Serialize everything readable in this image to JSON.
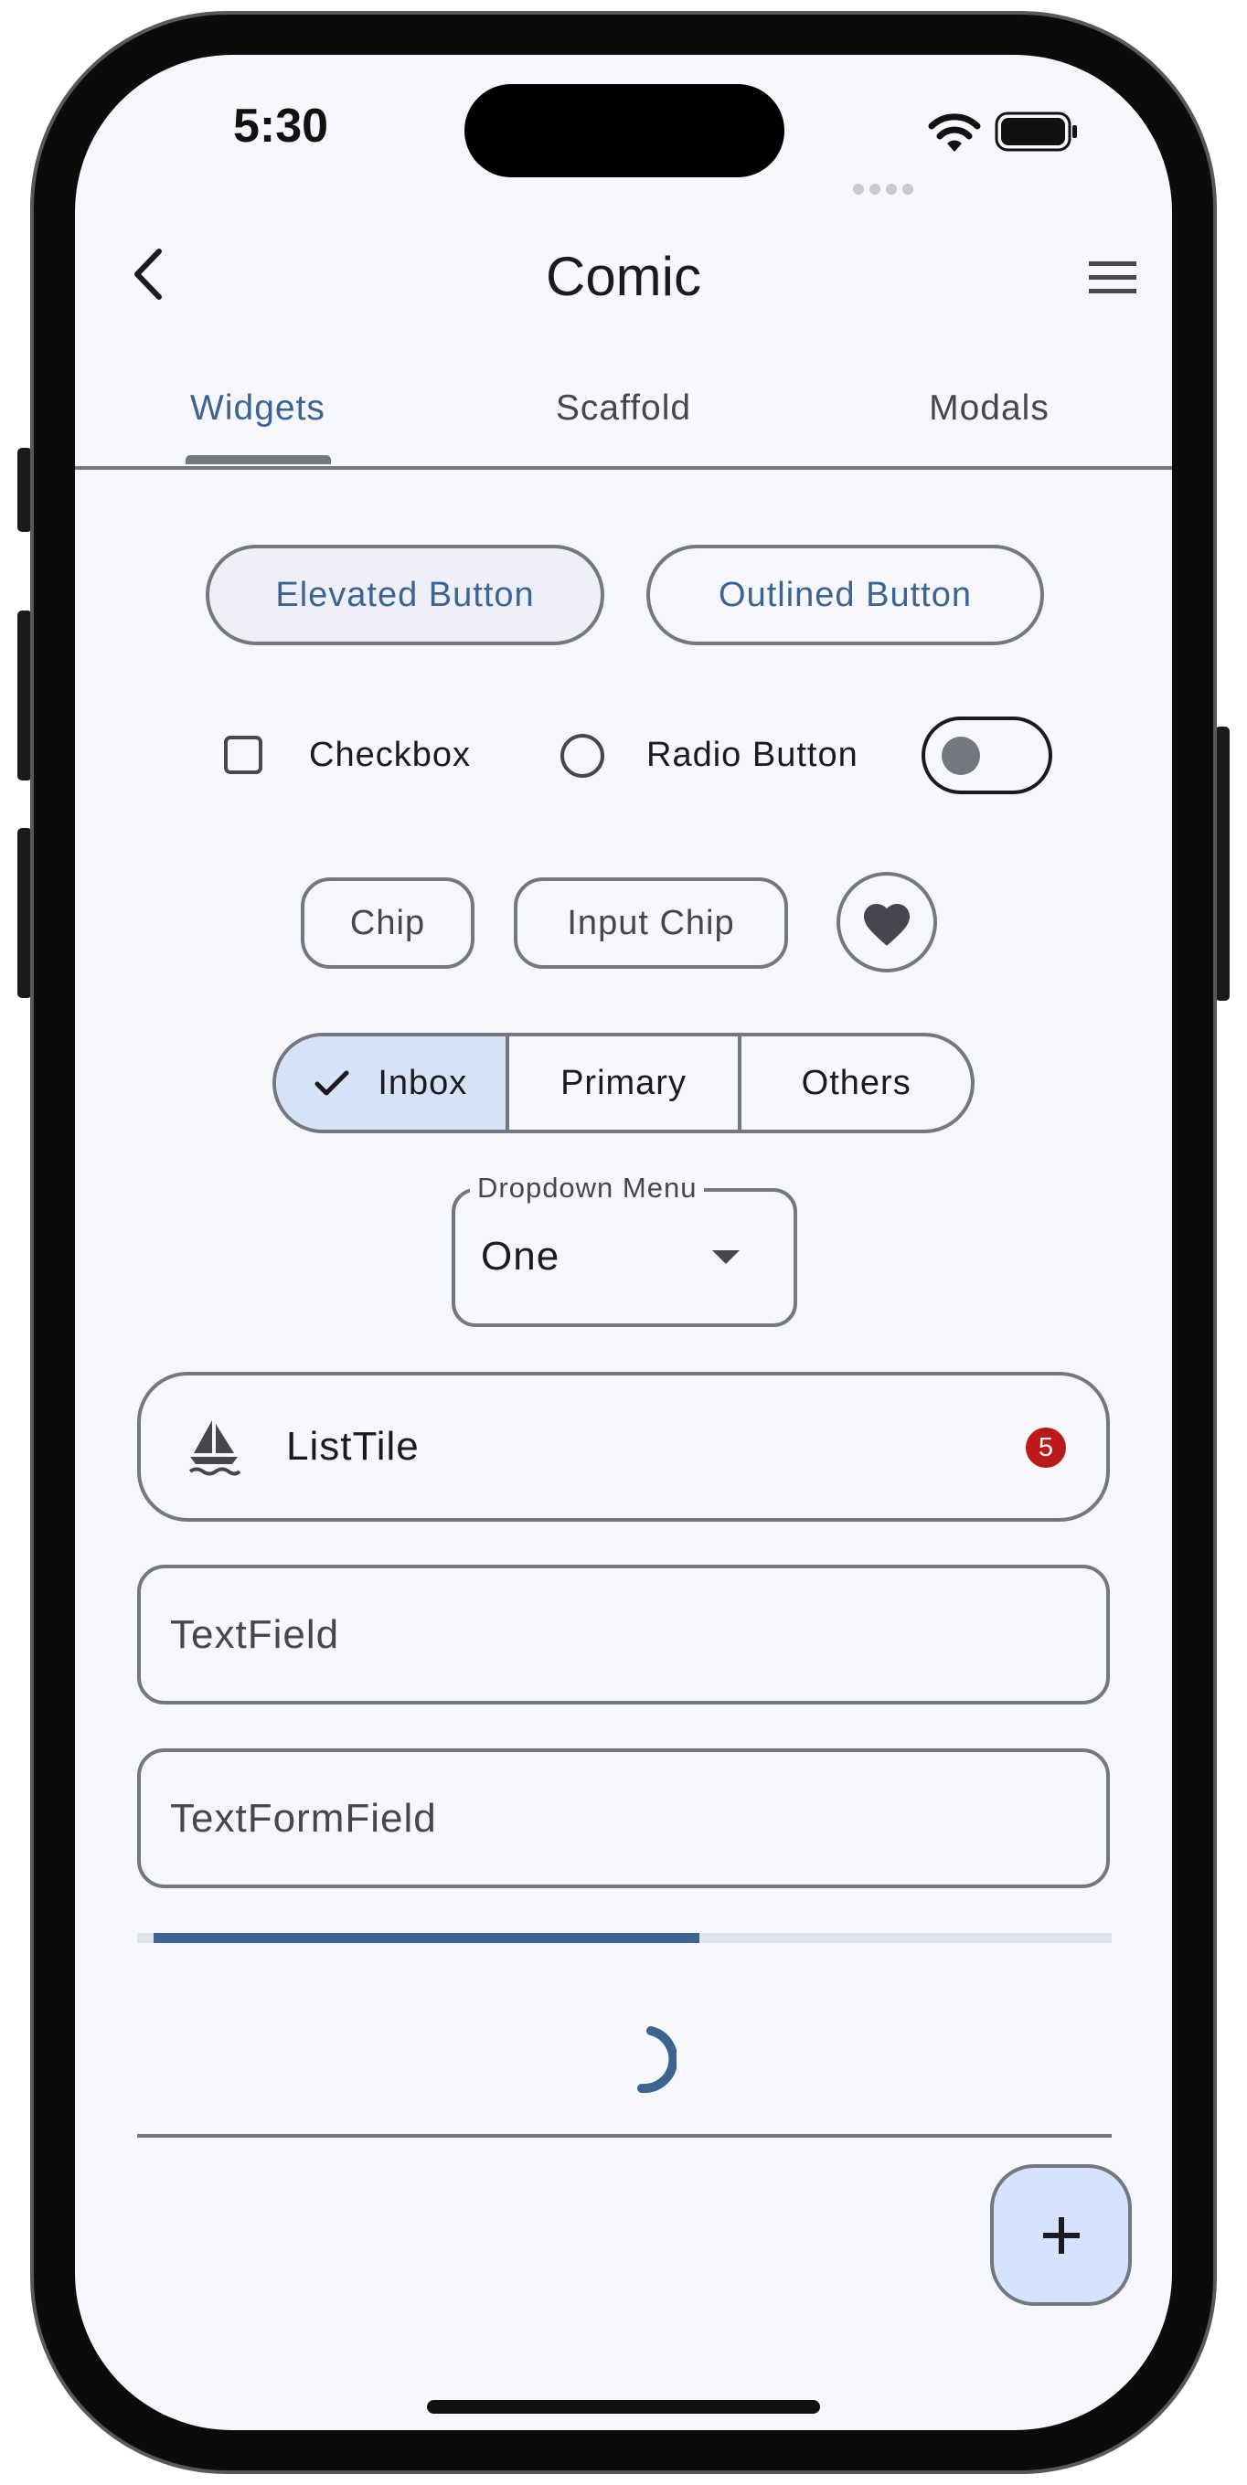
{
  "status_bar": {
    "time": "5:30"
  },
  "app_bar": {
    "title": "Comic"
  },
  "tabs": [
    {
      "label": "Widgets",
      "selected": true
    },
    {
      "label": "Scaffold",
      "selected": false
    },
    {
      "label": "Modals",
      "selected": false
    }
  ],
  "buttons": {
    "elevated": "Elevated Button",
    "outlined": "Outlined Button"
  },
  "controls": {
    "checkbox_label": "Checkbox",
    "radio_label": "Radio Button",
    "checkbox_checked": false,
    "radio_selected": false,
    "switch_on": false
  },
  "chips": {
    "chip": "Chip",
    "input_chip": "Input Chip"
  },
  "segmented": [
    {
      "label": "Inbox",
      "selected": true
    },
    {
      "label": "Primary",
      "selected": false
    },
    {
      "label": "Others",
      "selected": false
    }
  ],
  "dropdown": {
    "label": "Dropdown Menu",
    "value": "One"
  },
  "list_tile": {
    "title": "ListTile",
    "badge": "5"
  },
  "text_field": {
    "placeholder": "TextField"
  },
  "text_form_field": {
    "placeholder": "TextFormField"
  },
  "progress": {
    "value": 0.57
  },
  "colors": {
    "primary": "#3d6490",
    "error": "#ba1a1a",
    "outline": "#74777f",
    "surface": "#f6f7fc",
    "secondary_container": "#d6e3f7"
  },
  "icons": {
    "back": "chevron-left-icon",
    "menu": "menu-icon",
    "check": "check-icon",
    "favorite": "heart-icon",
    "list_leading": "sailboat-icon",
    "fab": "plus-icon"
  }
}
